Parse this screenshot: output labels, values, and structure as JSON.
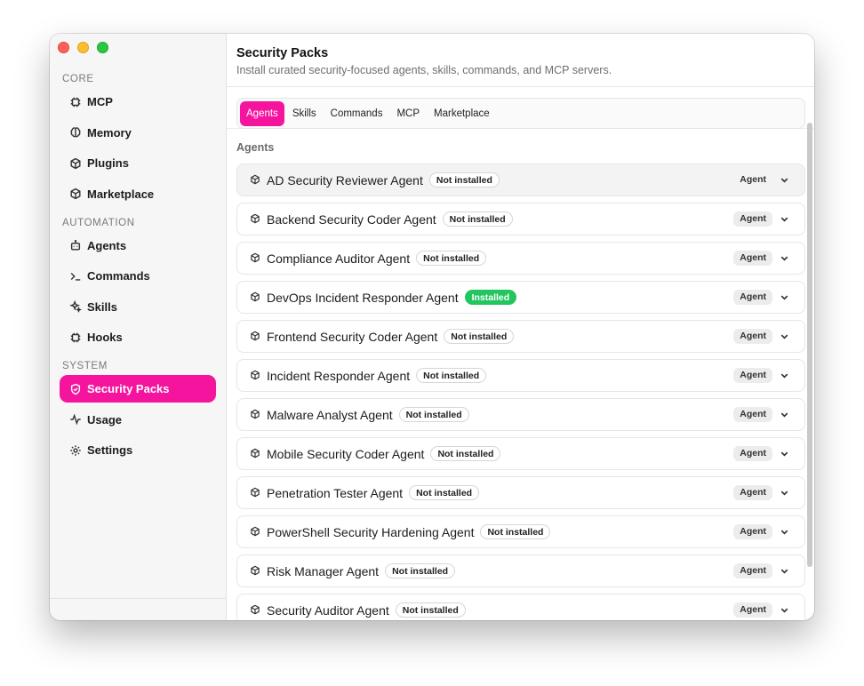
{
  "window": {
    "traffic_lights": [
      "close",
      "minimize",
      "zoom"
    ]
  },
  "sidebar": {
    "sections": [
      {
        "label": "CORE",
        "items": [
          {
            "label": "MCP",
            "icon": "chip-icon",
            "active": false
          },
          {
            "label": "Memory",
            "icon": "brain-icon",
            "active": false
          },
          {
            "label": "Plugins",
            "icon": "package-icon",
            "active": false
          },
          {
            "label": "Marketplace",
            "icon": "package-icon",
            "active": false
          }
        ]
      },
      {
        "label": "AUTOMATION",
        "items": [
          {
            "label": "Agents",
            "icon": "bot-icon",
            "active": false
          },
          {
            "label": "Commands",
            "icon": "terminal-icon",
            "active": false
          },
          {
            "label": "Skills",
            "icon": "sparkles-icon",
            "active": false
          },
          {
            "label": "Hooks",
            "icon": "chip-icon",
            "active": false
          }
        ]
      },
      {
        "label": "SYSTEM",
        "items": [
          {
            "label": "Security Packs",
            "icon": "shield-icon",
            "active": true
          },
          {
            "label": "Usage",
            "icon": "activity-icon",
            "active": false
          },
          {
            "label": "Settings",
            "icon": "gear-icon",
            "active": false
          }
        ]
      }
    ]
  },
  "header": {
    "title": "Security Packs",
    "subtitle": "Install curated security-focused agents, skills, commands, and MCP servers."
  },
  "tabs": [
    {
      "label": "Agents",
      "active": true
    },
    {
      "label": "Skills",
      "active": false
    },
    {
      "label": "Commands",
      "active": false
    },
    {
      "label": "MCP",
      "active": false
    },
    {
      "label": "Marketplace",
      "active": false
    }
  ],
  "section_heading": "Agents",
  "agents": [
    {
      "name": "AD Security Reviewer Agent",
      "status": "Not installed",
      "type": "Agent"
    },
    {
      "name": "Backend Security Coder Agent",
      "status": "Not installed",
      "type": "Agent"
    },
    {
      "name": "Compliance Auditor Agent",
      "status": "Not installed",
      "type": "Agent"
    },
    {
      "name": "DevOps Incident Responder Agent",
      "status": "Installed",
      "type": "Agent"
    },
    {
      "name": "Frontend Security Coder Agent",
      "status": "Not installed",
      "type": "Agent"
    },
    {
      "name": "Incident Responder Agent",
      "status": "Not installed",
      "type": "Agent"
    },
    {
      "name": "Malware Analyst Agent",
      "status": "Not installed",
      "type": "Agent"
    },
    {
      "name": "Mobile Security Coder Agent",
      "status": "Not installed",
      "type": "Agent"
    },
    {
      "name": "Penetration Tester Agent",
      "status": "Not installed",
      "type": "Agent"
    },
    {
      "name": "PowerShell Security Hardening Agent",
      "status": "Not installed",
      "type": "Agent"
    },
    {
      "name": "Risk Manager Agent",
      "status": "Not installed",
      "type": "Agent"
    },
    {
      "name": "Security Auditor Agent",
      "status": "Not installed",
      "type": "Agent"
    }
  ],
  "colors": {
    "accent": "#f5149e",
    "installed": "#22c55e"
  }
}
